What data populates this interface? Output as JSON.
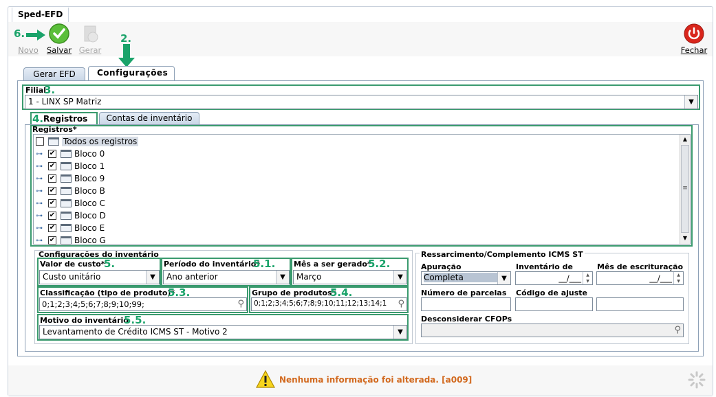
{
  "window": {
    "title": "Sped-EFD"
  },
  "toolbar": {
    "novo": "Novo",
    "salvar": "Salvar",
    "gerar": "Gerar",
    "fechar": "Fechar"
  },
  "annotations": {
    "a6": "6.",
    "a2": "2.",
    "a3": "3.",
    "a4": "4.",
    "a5": "5.",
    "a51": "5.1.",
    "a52": "5.2.",
    "a53": "5.3.",
    "a54": "5.4.",
    "a55": "5.5."
  },
  "tabs": {
    "gerar_efd": "Gerar EFD",
    "configuracoes": "Configurações"
  },
  "filial": {
    "label": "Filial",
    "value": "1 - LINX SP Matriz"
  },
  "subtabs": {
    "registros": "Registros",
    "contas": "Contas de inventário"
  },
  "registros": {
    "label": "Registros",
    "required": "*",
    "all": "Todos os registros",
    "items": [
      "Bloco 0",
      "Bloco 1",
      "Bloco 9",
      "Bloco B",
      "Bloco C",
      "Bloco D",
      "Bloco E",
      "Bloco G"
    ]
  },
  "inventario": {
    "title": "Configurações do inventário",
    "valor_label": "Valor de custo",
    "valor_value": "Custo unitário",
    "periodo_label": "Período do inventário",
    "periodo_value": "Ano anterior",
    "mes_label": "Mês a ser gerado",
    "mes_value": "Março",
    "classif_label": "Classificação (tipo de produto)",
    "classif_value": "0;1;2;3;4;5;6;7;8;9;10;99;",
    "grupo_label": "Grupo de produtos",
    "grupo_value": "0;1;2;3;4;5;6;7;8;9;10;11;12;13;14;1",
    "motivo_label": "Motivo do inventário",
    "motivo_value": "Levantamento de Crédito ICMS ST - Motivo 2",
    "req": "*"
  },
  "ressarcimento": {
    "title": "Ressarcimento/Complemento ICMS ST",
    "apuracao_label": "Apuração",
    "apuracao_value": "Completa",
    "inventario_label": "Inventário de",
    "inventario_value": "__/___",
    "mes_label": "Mês de escrituração",
    "mes_value": "__/___",
    "parcelas_label": "Número de parcelas",
    "ajuste_label": "Código de ajuste",
    "cfop_label": "Desconsiderar CFOPs"
  },
  "status": {
    "message": "Nenhuma informação foi alterada. [a009]"
  },
  "colors": {
    "accent_green": "#1aa36a",
    "status_orange": "#d2691e"
  }
}
